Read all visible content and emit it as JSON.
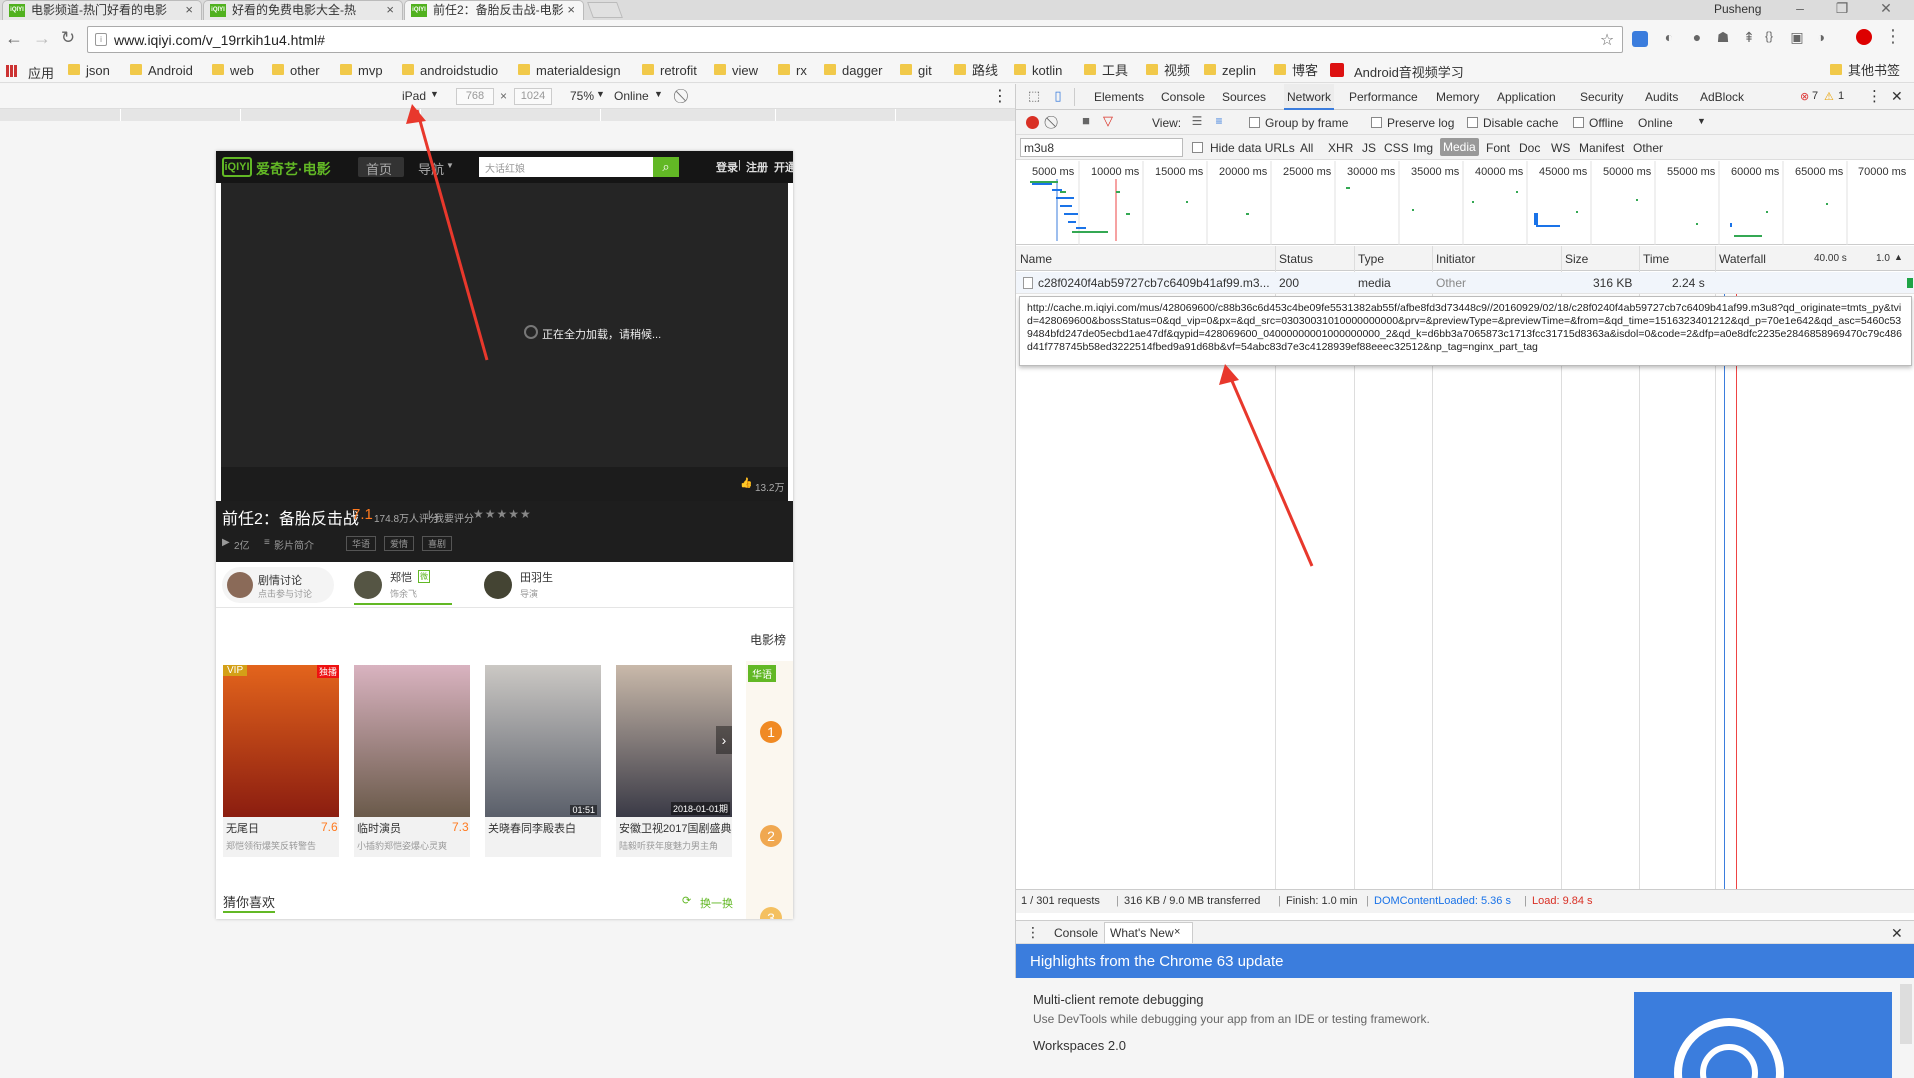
{
  "tabs": [
    {
      "title": "电影频道-热门好看的电影",
      "fav": "iQIYI"
    },
    {
      "title": "好看的免费电影大全-热",
      "fav": "iQIYI"
    },
    {
      "title": "前任2：备胎反击战-电影",
      "fav": "iQIYI"
    }
  ],
  "user": "Pusheng",
  "url": "www.iqiyi.com/v_19rrkih1u4.html#",
  "bookmarks": [
    "应用",
    "json",
    "Android",
    "web",
    "other",
    "mvp",
    "androidstudio",
    "materialdesign",
    "retrofit",
    "view",
    "rx",
    "dagger",
    "git",
    "路线",
    "kotlin",
    "工具",
    "视频",
    "zeplin",
    "博客",
    "Android音视频学习"
  ],
  "bookmarks_other": "其他书签",
  "device": {
    "name": "iPad",
    "width": "768",
    "height": "1024",
    "zoom": "75%",
    "throttle": "Online"
  },
  "site": {
    "logo": "爱奇艺·电影",
    "nav": [
      "首页",
      "导航"
    ],
    "search_placeholder": "大话红娘",
    "login": "登录",
    "register": "注册",
    "open": "开通",
    "loading": "正在全力加载，请稍候...",
    "likes": "13.2万",
    "title": "前任2：备胎反击战",
    "score": "7.1",
    "ratings": "174.8万人评分",
    "my_rating": "我要评分",
    "plays": "2亿",
    "intro": "影片简介",
    "tags": [
      "华语",
      "爱情",
      "喜剧"
    ],
    "people": [
      {
        "name": "剧情讨论",
        "role": "点击参与讨论"
      },
      {
        "name": "郑恺",
        "role": "饰余飞",
        "badge": "微"
      },
      {
        "name": "田羽生",
        "role": "导演"
      }
    ],
    "ranking": "电影榜",
    "ranking_tag": "华语",
    "posters": [
      {
        "title": "无尾日",
        "score": "7.6",
        "sub": "郑恺领衔爆笑反转警告",
        "badge": "VIP",
        "corner": "独播"
      },
      {
        "title": "临时演员",
        "score": "7.3",
        "sub": "小插豹郑恺姿爆心灵爽"
      },
      {
        "title": "关晓春同李殿表白",
        "sub": "",
        "time": "01:51"
      },
      {
        "title": "安徽卫视2017国剧盛典",
        "sub": "陆毅听获年度魅力男主角",
        "time": "2018-01-01期"
      }
    ],
    "guess": "猜你喜欢",
    "refresh": "换一换",
    "rank_nums": [
      "1",
      "2",
      "3"
    ]
  },
  "devtools": {
    "tabs": [
      "Elements",
      "Console",
      "Sources",
      "Network",
      "Performance",
      "Memory",
      "Application",
      "Security",
      "Audits",
      "AdBlock"
    ],
    "errors": "7",
    "warnings": "1",
    "toolbar": {
      "view": "View:",
      "group": "Group by frame",
      "preserve": "Preserve log",
      "disable_cache": "Disable cache",
      "offline": "Offline",
      "online": "Online"
    },
    "filter_value": "m3u8",
    "hide_data": "Hide data URLs",
    "types": [
      "All",
      "XHR",
      "JS",
      "CSS",
      "Img",
      "Media",
      "Font",
      "Doc",
      "WS",
      "Manifest",
      "Other"
    ],
    "timeline_ticks": [
      "5000 ms",
      "10000 ms",
      "15000 ms",
      "20000 ms",
      "25000 ms",
      "30000 ms",
      "35000 ms",
      "40000 ms",
      "45000 ms",
      "50000 ms",
      "55000 ms",
      "60000 ms",
      "65000 ms",
      "70000 ms"
    ],
    "columns": [
      "Name",
      "Status",
      "Type",
      "Initiator",
      "Size",
      "Time",
      "Waterfall"
    ],
    "waterfall_time": "40.00 s",
    "waterfall_scale": "1.0",
    "row": {
      "name": "c28f0240f4ab59727cb7c6409b41af99.m3...",
      "status": "200",
      "type": "media",
      "initiator": "Other",
      "size": "316 KB",
      "time": "2.24 s"
    },
    "tooltip": "http://cache.m.iqiyi.com/mus/428069600/c88b36c6d453c4be09fe5531382ab55f/afbe8fd3d73448c9//20160929/02/18/c28f0240f4ab59727cb7c6409b41af99.m3u8?qd_originate=tmts_py&tvid=428069600&bossStatus=0&qd_vip=0&px=&qd_src=03030031010000000000&prv=&previewType=&previewTime=&from=&qd_time=1516323401212&qd_p=70e1e642&qd_asc=5460c539484bfd247de05ecbd1ae47df&qypid=428069600_04000000001000000000_2&qd_k=d6bb3a7065873c1713fcc31715d8363a&isdol=0&code=2&dfp=a0e8dfc2235e2846858969470c79c486d41f778745b58ed3222514fbed9a91d68b&vf=54abc83d7e3c4128939ef88eeec32512&np_tag=nginx_part_tag",
    "status": {
      "requests": "1 / 301 requests",
      "transferred": "316 KB / 9.0 MB transferred",
      "finish": "Finish: 1.0 min",
      "dcl": "DOMContentLoaded: 5.36 s",
      "load": "Load: 9.84 s"
    },
    "drawer_tabs": [
      "Console",
      "What's New"
    ],
    "whatsnew_title": "Highlights from the Chrome 63 update",
    "items": [
      {
        "title": "Multi-client remote debugging",
        "desc": "Use DevTools while debugging your app from an IDE or testing framework."
      },
      {
        "title": "Workspaces 2.0",
        "desc": ""
      }
    ]
  }
}
